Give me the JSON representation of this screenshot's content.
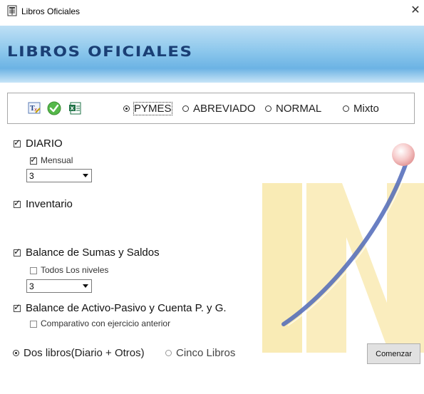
{
  "window": {
    "title": "Libros Oficiales",
    "close_glyph": "✕"
  },
  "banner": {
    "title": "LIBROS OFICIALES"
  },
  "toolbar": {
    "icons": [
      "text-document-icon",
      "green-check-icon",
      "excel-icon"
    ],
    "plan_options": [
      {
        "label": "PYMES",
        "selected": true
      },
      {
        "label": "ABREVIADO",
        "selected": false
      },
      {
        "label": "NORMAL",
        "selected": false
      },
      {
        "label": "Mixto",
        "selected": false
      }
    ]
  },
  "diario": {
    "label": "DIARIO",
    "checked": true,
    "mensual_label": "Mensual",
    "mensual_checked": true,
    "month_value": "3"
  },
  "inventario": {
    "label": "Inventario",
    "checked": true
  },
  "balance_sumas": {
    "label": "Balance de Sumas y Saldos",
    "checked": true,
    "todos_label": "Todos Los niveles",
    "todos_checked": false,
    "level_value": "3"
  },
  "balance_activo": {
    "label": "Balance de Activo-Pasivo y Cuenta P. y G.",
    "checked": true,
    "comparativo_label": "Comparativo con ejercicio anterior",
    "comparativo_checked": false
  },
  "libros": {
    "options": [
      {
        "label": "Dos libros(Diario + Otros)",
        "selected": true
      },
      {
        "label": "Cinco Libros",
        "selected": false
      }
    ]
  },
  "actions": {
    "start_label": "Comenzar"
  },
  "colors": {
    "banner_text": "#1a3f75",
    "logo_yellow": "#f8e7a8",
    "logo_blue": "#4f68b8"
  }
}
